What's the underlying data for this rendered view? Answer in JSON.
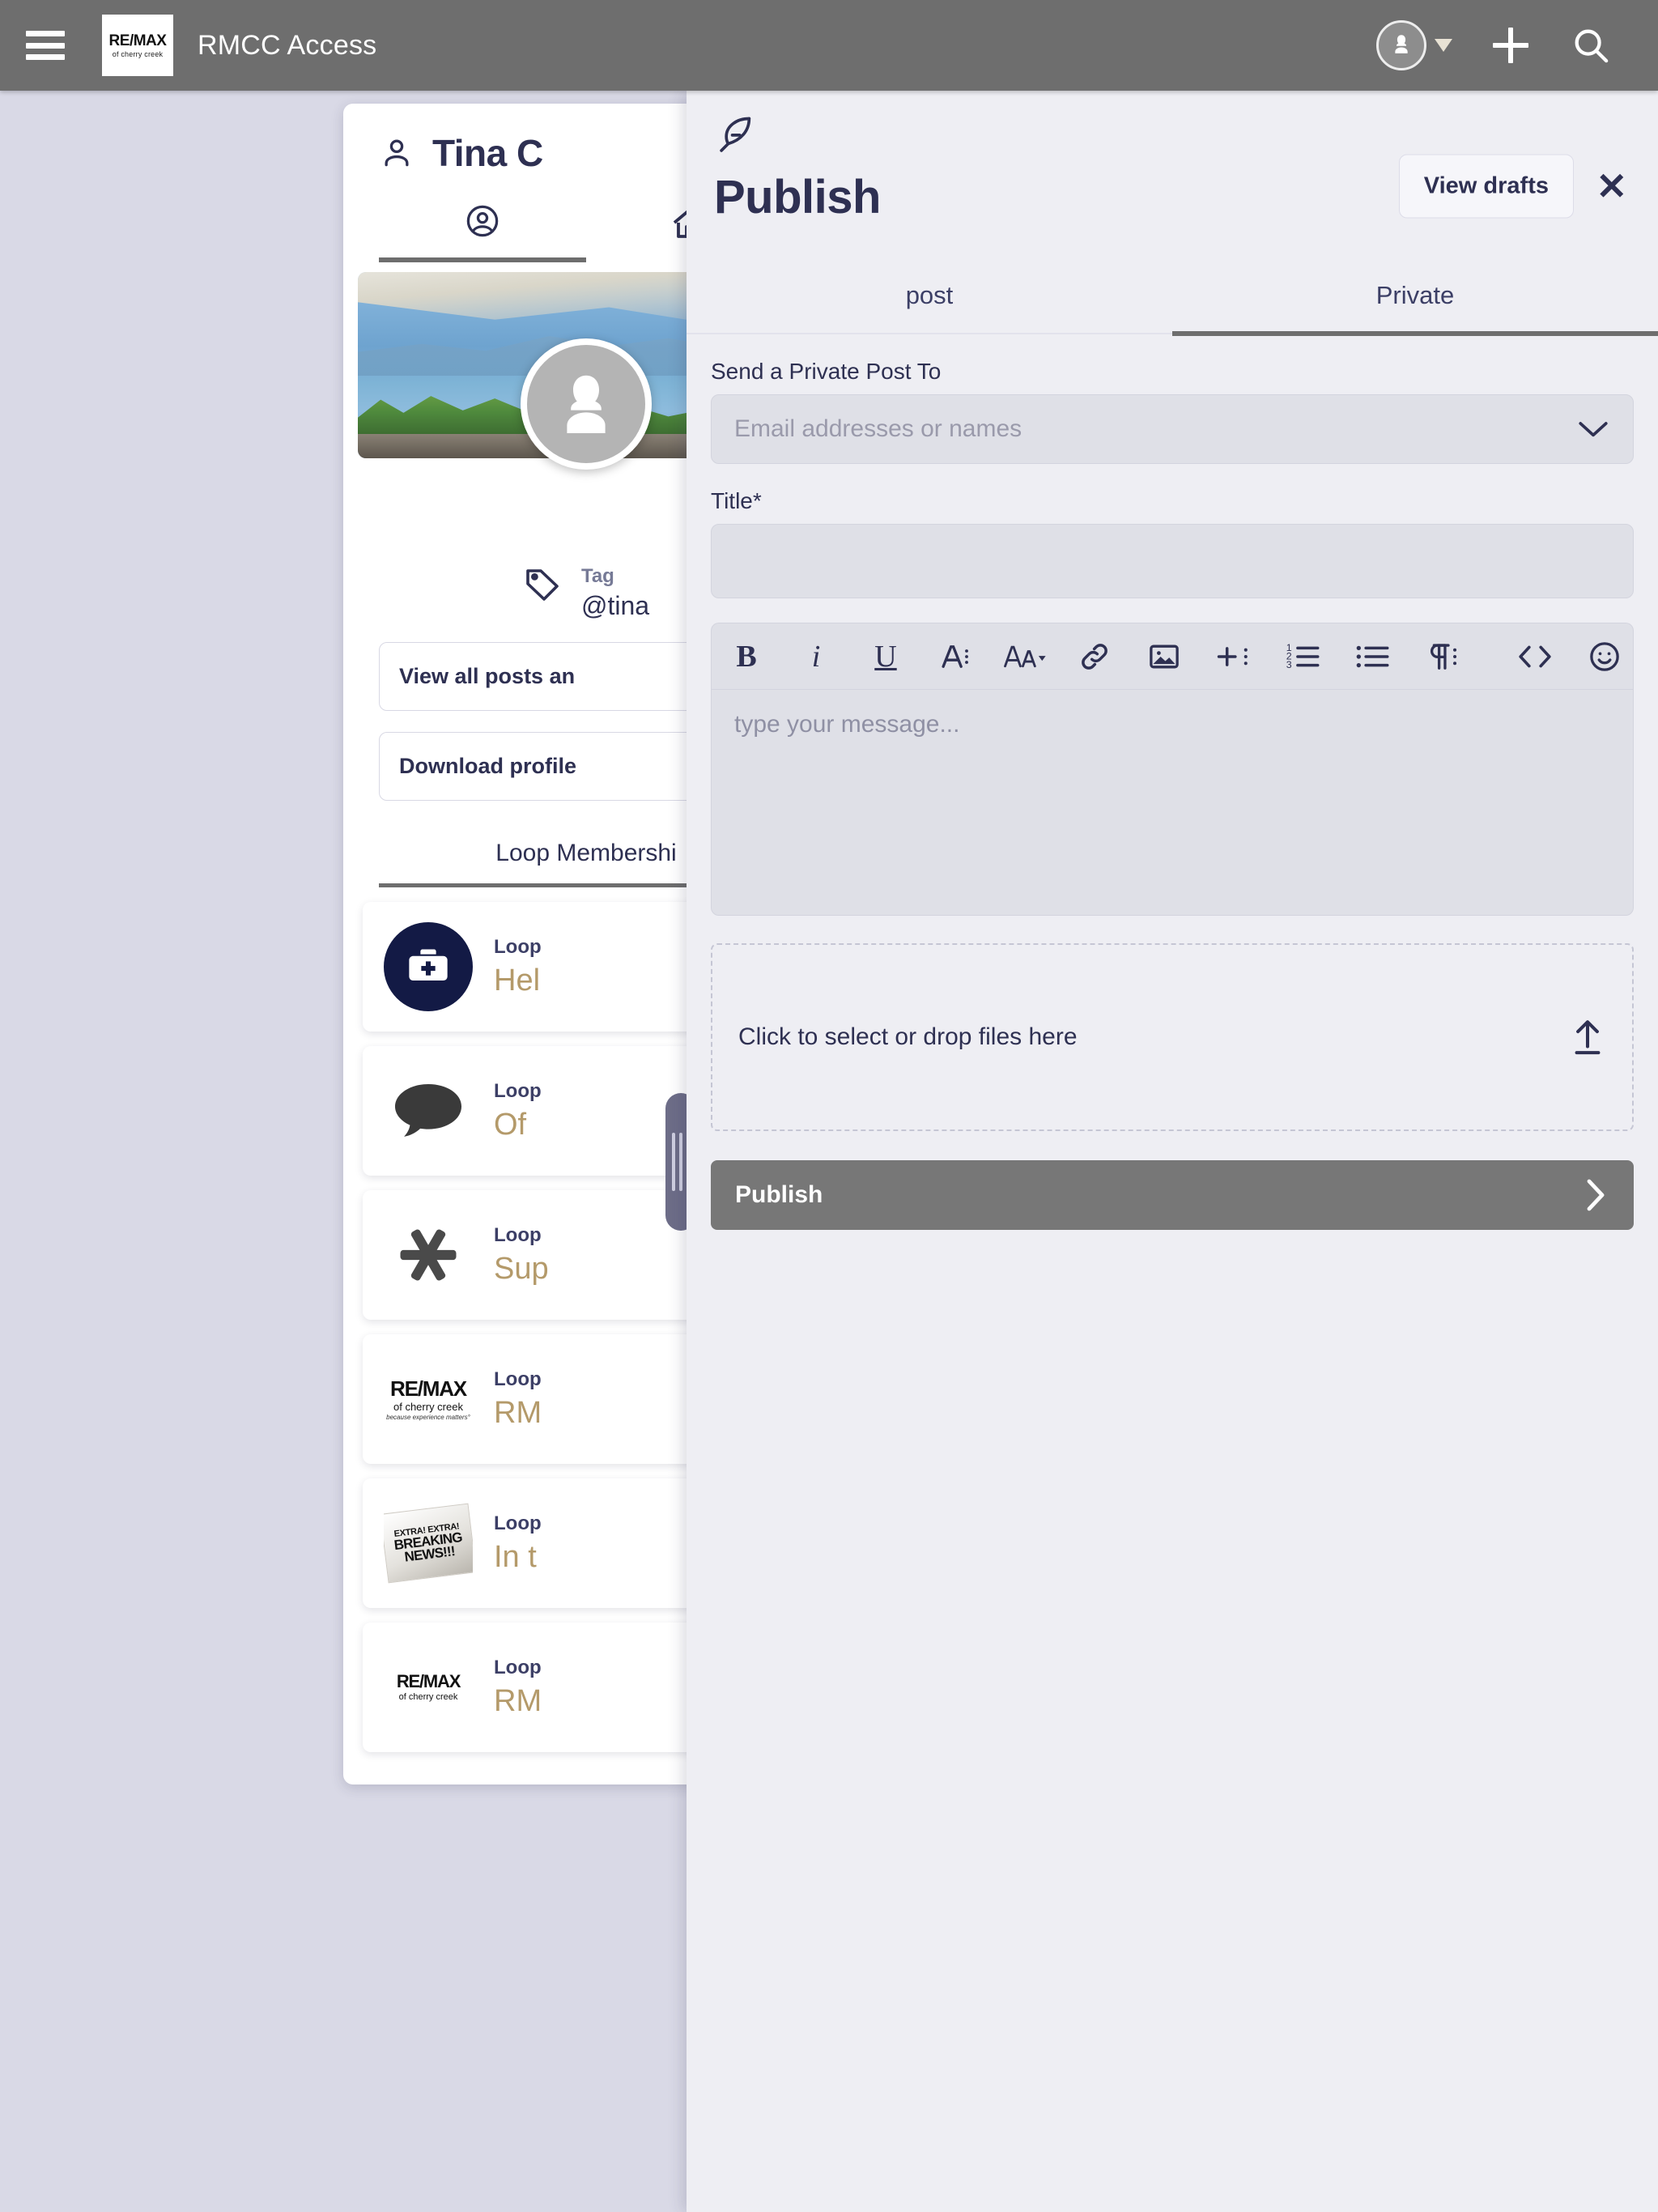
{
  "topbar": {
    "menu_icon": "hamburger-icon",
    "logo": {
      "line1": "RE/MAX",
      "line2": "of cherry creek"
    },
    "title": "RMCC Access",
    "account_icon": "user-avatar-icon",
    "caret_icon": "caret-down-icon",
    "add_icon": "plus-icon",
    "search_icon": "search-icon"
  },
  "profile": {
    "name": "Tina C",
    "person_icon": "person-outline-icon",
    "tabs": [
      {
        "icon": "profile-circle-icon",
        "active": true
      },
      {
        "icon": "home-icon",
        "active": false
      }
    ],
    "cover_image_alt": "mountain landscape cover photo",
    "avatar_icon": "female-avatar-icon",
    "tag_label": "Tag",
    "tag_handle": "@tina",
    "buttons": [
      {
        "label": "View all posts an"
      },
      {
        "label": "Download profile"
      }
    ],
    "section_title": "Loop Membershi",
    "loops": [
      {
        "kicker": "Loop",
        "name": "Hel",
        "icon": "medical-briefcase-icon"
      },
      {
        "kicker": "Loop",
        "name": "Of",
        "icon": "speech-bubble-icon"
      },
      {
        "kicker": "Loop",
        "name": "Sup",
        "icon": "asterisk-icon"
      },
      {
        "kicker": "Loop",
        "name": "RM",
        "icon": "remax-cherry-creek-logo",
        "logo": {
          "l1": "RE/MAX",
          "l2": "of cherry creek",
          "l3": "because experience matters°"
        }
      },
      {
        "kicker": "Loop",
        "name": "In t",
        "icon": "breaking-news-icon",
        "news": {
          "l1": "EXTRA! EXTRA!",
          "l2": "BREAKING",
          "l3": "NEWS!!!"
        }
      },
      {
        "kicker": "Loop",
        "name": "RM",
        "icon": "remax-balloon-logo",
        "logo": {
          "l1": "RE/MAX",
          "l2": "of cherry creek"
        }
      }
    ],
    "scrollbar": "vertical-scroll-handle"
  },
  "publish": {
    "feather_icon": "feather-quill-icon",
    "view_drafts_label": "View drafts",
    "close_icon": "close-icon",
    "title": "Publish",
    "tabs": [
      {
        "label": "post",
        "active": false
      },
      {
        "label": "Private",
        "active": true
      }
    ],
    "recipient": {
      "label": "Send a Private Post To",
      "placeholder": "Email addresses or names",
      "value": "",
      "chevron_icon": "chevron-down-icon"
    },
    "title_field": {
      "label": "Title*",
      "placeholder": "",
      "value": ""
    },
    "toolbar": [
      {
        "name": "bold-button",
        "glyph": "B"
      },
      {
        "name": "italic-button",
        "glyph": "i"
      },
      {
        "name": "underline-button",
        "glyph": "U"
      },
      {
        "name": "text-color-button",
        "glyph": "A"
      },
      {
        "name": "font-size-button",
        "glyph": "AA"
      },
      {
        "name": "link-button",
        "glyph": "link"
      },
      {
        "name": "image-button",
        "glyph": "image"
      },
      {
        "name": "insert-button",
        "glyph": "plus"
      },
      {
        "name": "ordered-list-button",
        "glyph": "123-list"
      },
      {
        "name": "unordered-list-button",
        "glyph": "bullet-list"
      },
      {
        "name": "paragraph-button",
        "glyph": "pilcrow"
      },
      {
        "name": "code-button",
        "glyph": "code"
      },
      {
        "name": "emoji-button",
        "glyph": "smiley"
      },
      {
        "name": "more-options-button",
        "glyph": "kebab"
      }
    ],
    "editor": {
      "placeholder": "type your message...",
      "value": ""
    },
    "dropzone": {
      "label": "Click to select or drop files here",
      "icon": "upload-icon"
    },
    "publish_button": {
      "label": "Publish",
      "icon": "chevron-right-icon"
    }
  },
  "colors": {
    "page_bg": "#d9d9e6",
    "topbar_bg": "#6e6e6e",
    "panel_bg": "#eeeef3",
    "field_bg": "#dfe0e7",
    "ink": "#2e3052",
    "gold": "#b49a6a",
    "publish_btn": "#777777"
  }
}
